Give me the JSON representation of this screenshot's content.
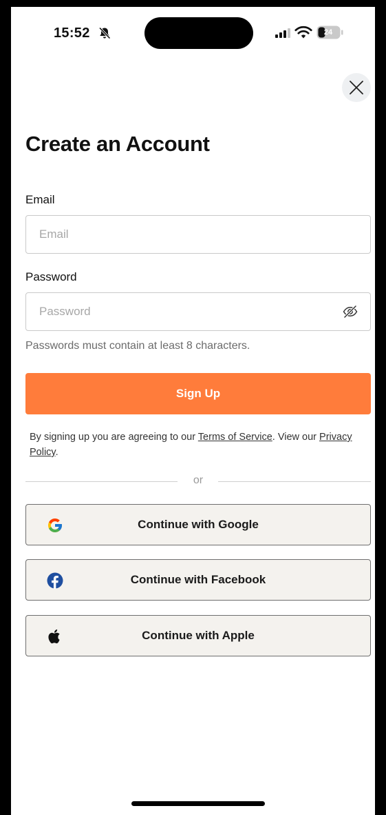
{
  "status_bar": {
    "time": "15:52",
    "battery": "24",
    "icons": [
      "bell-slash-icon",
      "signal-icon",
      "wifi-icon",
      "battery-icon"
    ]
  },
  "header": {
    "close_icon": "close-icon",
    "title": "Create an Account"
  },
  "form": {
    "email": {
      "label": "Email",
      "placeholder": "Email",
      "value": ""
    },
    "password": {
      "label": "Password",
      "placeholder": "Password",
      "value": "",
      "toggle_icon": "eye-slash-icon"
    },
    "helper": "Passwords must contain at least 8 characters.",
    "submit_label": "Sign Up"
  },
  "legal": {
    "prefix": "By signing up you are agreeing to our ",
    "terms_link": "Terms of Service",
    "middle": ". View our ",
    "privacy_link": "Privacy Policy",
    "suffix": "."
  },
  "divider": {
    "label": "or"
  },
  "social": [
    {
      "label": "Continue with Google",
      "icon": "google-icon"
    },
    {
      "label": "Continue with Facebook",
      "icon": "facebook-icon"
    },
    {
      "label": "Continue with Apple",
      "icon": "apple-icon"
    }
  ],
  "colors": {
    "accent": "#ff7c3b",
    "social_button_bg": "#f4f2ee",
    "close_button_bg": "#eef0f2",
    "facebook_blue": "#1f4fa0"
  }
}
